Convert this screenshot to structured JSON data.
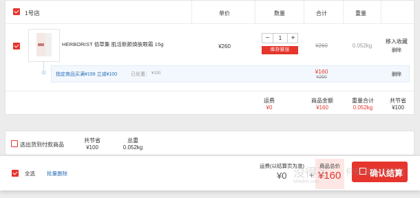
{
  "store": {
    "name": "1号店"
  },
  "columns": {
    "price": "单价",
    "qty": "数量",
    "total": "合计",
    "weight": "重量"
  },
  "item": {
    "name": "HERBORIST 佰草集 肌活新颜焕肤眼霜 15g",
    "price": "¥260",
    "qty": "1",
    "minus": "−",
    "plus": "+",
    "stock_tag": "库存紧张",
    "total_old": "¥260",
    "weight": "0.052kg",
    "action_fav": "移入收藏",
    "action_del": "删除"
  },
  "promo": {
    "text": "指定商品买满¥199 立减¥100",
    "discount_label": "已优惠：",
    "discount_value": "¥100",
    "total_new": "¥160",
    "total_old": "¥260",
    "delete": "删除"
  },
  "store_summary": {
    "freight_label": "运费",
    "freight_value": "¥0",
    "amount_label": "商品金额",
    "amount_value": "¥160",
    "weight_label": "重量合计",
    "weight_value": "0.052kg",
    "saved_label": "共节省",
    "saved_value": "¥100"
  },
  "cod": {
    "label": "选出货到付款商品",
    "saved_label": "共节省",
    "saved_value": "¥100",
    "weight_label": "总重",
    "weight_value": "0.052kg"
  },
  "footer": {
    "select_all": "全选",
    "batch_delete": "批量删除",
    "freight_label": "运费(以结算页为准)",
    "freight_value": "¥0",
    "plus": "+",
    "total_label": "商品总价",
    "total_value": "¥160",
    "checkout": "确认结算"
  },
  "watermark": {
    "cn": "没得买",
    "en": "Meideli.com",
    "slogan": "何值得买 值得买"
  },
  "colors": {
    "accent": "#e5352d",
    "promo_bg": "#f3f8fe",
    "promo_text": "#2a6fb5"
  }
}
